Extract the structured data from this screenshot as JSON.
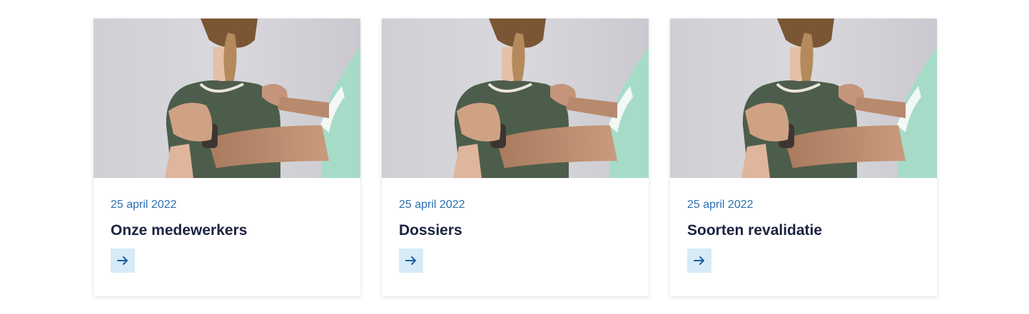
{
  "colors": {
    "date": "#2b6fb0",
    "title": "#1c2340",
    "arrow_bg": "#d6ebf7",
    "arrow_fg": "#1f5f9e"
  },
  "cards": [
    {
      "date": "25 april 2022",
      "title": "Onze medewerkers",
      "image": "physiotherapist-massaging-shoulders-photo",
      "icon": "arrow-right-icon"
    },
    {
      "date": "25 april 2022",
      "title": "Dossiers",
      "image": "physiotherapist-massaging-shoulders-photo",
      "icon": "arrow-right-icon"
    },
    {
      "date": "25 april 2022",
      "title": "Soorten revalidatie",
      "image": "physiotherapist-massaging-shoulders-photo",
      "icon": "arrow-right-icon"
    }
  ]
}
